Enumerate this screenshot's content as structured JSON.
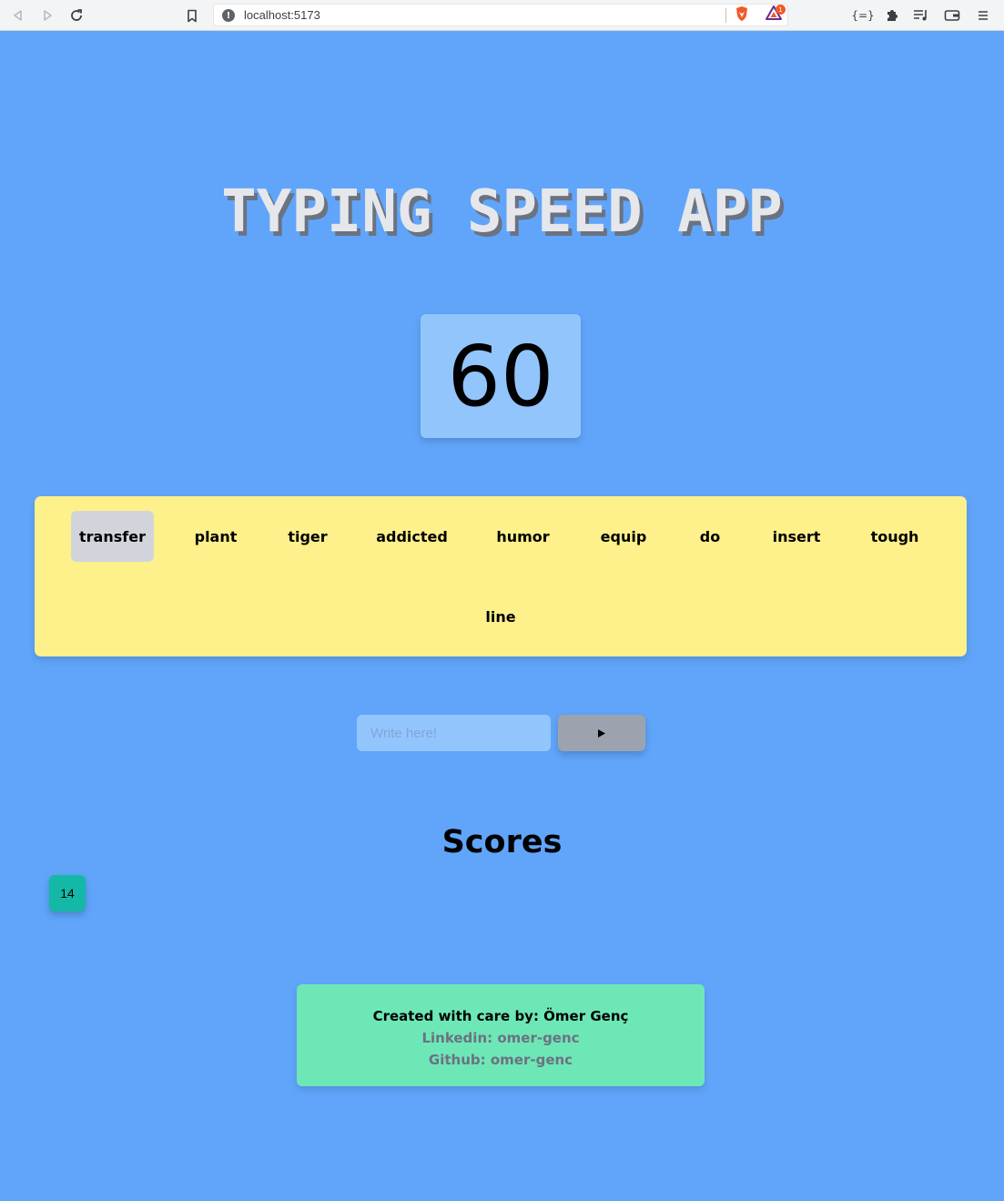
{
  "browser": {
    "url": "localhost:5173",
    "bat_badge": "1",
    "icons": [
      "back-icon",
      "forward-icon",
      "reload-icon",
      "bookmark-icon",
      "site-info-icon",
      "brave-shields-icon",
      "brave-rewards-icon",
      "extension-braces-icon",
      "extensions-puzzle-icon",
      "media-playlist-icon",
      "wallet-icon",
      "menu-icon"
    ]
  },
  "app": {
    "title": "TYPING SPEED APP",
    "timer": "60",
    "words": [
      "transfer",
      "plant",
      "tiger",
      "addicted",
      "humor",
      "equip",
      "do",
      "insert",
      "tough",
      "line"
    ],
    "active_word_index": 0,
    "input_placeholder": "Write here!",
    "input_value": "",
    "play_icon": "play-icon",
    "scores_title": "Scores",
    "scores": [
      "14"
    ]
  },
  "footer": {
    "credit": "Created with care by: Ömer Genç",
    "linkedin": "Linkedin: omer-genc",
    "github": "Github: omer-genc"
  },
  "colors": {
    "background": "#60a5fa",
    "timer_bg": "#93c5fd",
    "words_bg": "#fef08a",
    "active_word_bg": "#d1d5db",
    "play_bg": "#9ca3af",
    "score_chip_bg": "#14b8a6",
    "footer_bg": "#6ee7b7"
  }
}
